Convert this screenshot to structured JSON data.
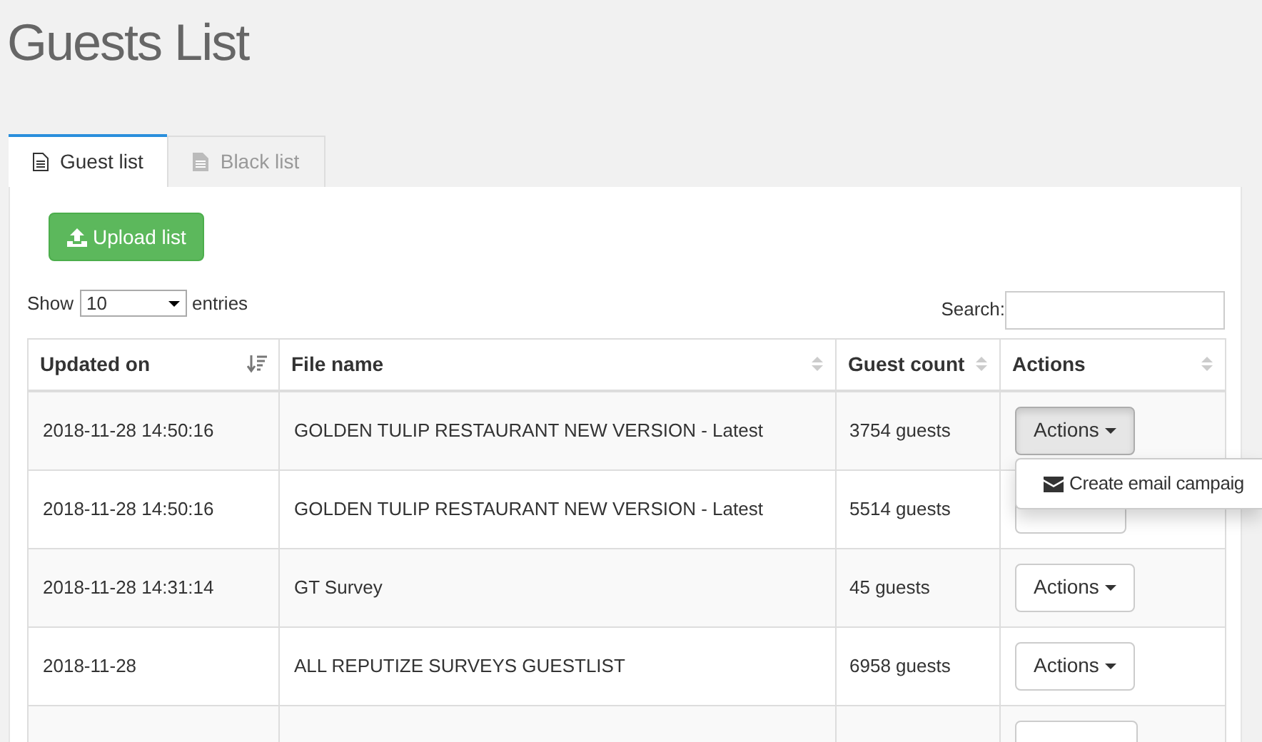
{
  "page_title": "Guests List",
  "tabs": [
    {
      "label": "Guest list",
      "selected": true
    },
    {
      "label": "Black list",
      "selected": false
    }
  ],
  "upload_button": "Upload list",
  "length_control": {
    "prefix": "Show",
    "value": "10",
    "suffix": "entries"
  },
  "search": {
    "label": "Search:"
  },
  "table": {
    "columns": [
      {
        "label": "Updated on",
        "sorted": true
      },
      {
        "label": "File name",
        "sorted": false
      },
      {
        "label": "Guest count",
        "sorted": false
      },
      {
        "label": "Actions",
        "sorted": false
      }
    ],
    "rows": [
      {
        "updated_on": "2018-11-28 14:50:16",
        "file_name": "GOLDEN TULIP RESTAURANT NEW VERSION - Latest",
        "guest_count": "3754 guests",
        "action": "Actions",
        "open": true
      },
      {
        "updated_on": "2018-11-28 14:50:16",
        "file_name": "GOLDEN TULIP RESTAURANT NEW VERSION - Latest",
        "guest_count": "5514 guests",
        "open": false
      },
      {
        "updated_on": "2018-11-28 14:31:14",
        "file_name": "GT Survey",
        "guest_count": "45 guests",
        "action": "Actions",
        "open": false
      },
      {
        "updated_on": "2018-11-28",
        "file_name": "ALL REPUTIZE SURVEYS GUESTLIST",
        "guest_count": "6958 guests",
        "action": "Actions",
        "open": false
      }
    ]
  },
  "dropdown_menu": {
    "items": [
      "Create email campaig"
    ]
  }
}
